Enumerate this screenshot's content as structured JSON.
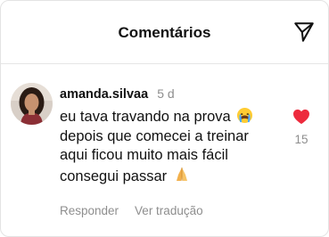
{
  "header": {
    "title": "Comentários",
    "share_icon": "send-icon"
  },
  "comment": {
    "author": "amanda.silvaa",
    "time_ago": "5 d",
    "lines": [
      "eu tava travando na prova",
      "depois que comecei a treinar",
      "aqui ficou muito mais fácil",
      "consegui passar"
    ],
    "emojis": [
      "crying-face",
      "folded-hands"
    ],
    "reply_label": "Responder",
    "translate_label": "Ver tradução",
    "likes": "15",
    "liked": true
  },
  "colors": {
    "like": "#ed2a3d",
    "muted_text": "#8e8e8e",
    "divider": "#e6e6e6"
  }
}
